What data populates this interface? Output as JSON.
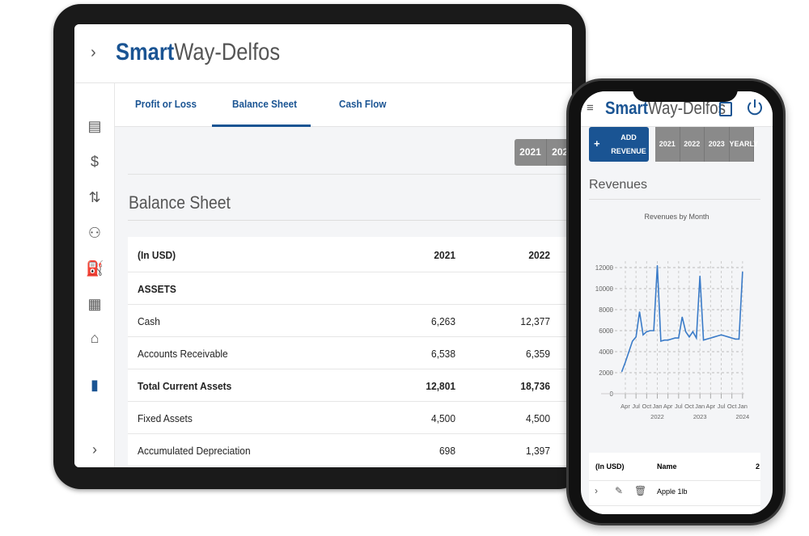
{
  "tablet": {
    "logo": {
      "bold": "Smart",
      "rest": "Way-Delfos"
    },
    "expand_icon": "chevron-right-icon",
    "header_icons": [
      "clipboard-icon",
      "power-icon"
    ],
    "sidebar_icons": [
      "dashboard-icon",
      "dollar-icon",
      "transfer-icon",
      "people-icon",
      "fuel-icon",
      "building-icon",
      "bank-icon",
      "document-icon"
    ],
    "tabs": [
      {
        "label": "Profit or Loss"
      },
      {
        "label": "Balance Sheet",
        "active": true
      },
      {
        "label": "Cash Flow"
      }
    ],
    "year_buttons": [
      "2021",
      "2022"
    ],
    "title": "Balance Sheet",
    "table": {
      "header": [
        "(In USD)",
        "2021",
        "2022"
      ],
      "rows": [
        {
          "label": "ASSETS",
          "v2021": "",
          "v2022": "",
          "bold": true
        },
        {
          "label": "Cash",
          "v2021": "6,263",
          "v2022": "12,377"
        },
        {
          "label": "Accounts Receivable",
          "v2021": "6,538",
          "v2022": "6,359"
        },
        {
          "label": "Total Current Assets",
          "v2021": "12,801",
          "v2022": "18,736",
          "bold": true
        },
        {
          "label": "Fixed Assets",
          "v2021": "4,500",
          "v2022": "4,500"
        },
        {
          "label": "Accumulated Depreciation",
          "v2021": "698",
          "v2022": "1,397"
        }
      ]
    }
  },
  "phone": {
    "logo": {
      "bold": "Smart",
      "rest": "Way-Delfos"
    },
    "add_button": {
      "icon": "+",
      "line1": "ADD",
      "line2": "REVENUE"
    },
    "period_buttons": [
      "2021",
      "2022",
      "2023",
      "YEARLY"
    ],
    "section_title": "Revenues",
    "table": {
      "header": [
        "(In USD)",
        "Name",
        "2"
      ],
      "rows": [
        {
          "name": "Apple 1lb"
        }
      ]
    }
  },
  "colors": {
    "brand": "#1a5493",
    "line": "#3a7bc8",
    "button_gray": "#8a8a8a"
  },
  "chart_data": {
    "type": "line",
    "title": "Revenues by Month",
    "x": [
      "2021-03",
      "2021-04",
      "2021-05",
      "2021-06",
      "2021-07",
      "2021-08",
      "2021-09",
      "2021-10",
      "2021-11",
      "2021-12",
      "2022-01",
      "2022-02",
      "2022-03",
      "2022-04",
      "2022-05",
      "2022-06",
      "2022-07",
      "2022-08",
      "2022-09",
      "2022-10",
      "2022-11",
      "2022-12",
      "2023-01",
      "2023-02",
      "2023-03",
      "2023-04",
      "2023-05",
      "2023-06",
      "2023-07",
      "2023-08",
      "2023-09",
      "2023-10",
      "2023-11",
      "2023-12",
      "2024-01"
    ],
    "values": [
      2100,
      3000,
      4000,
      5000,
      5400,
      7800,
      5600,
      5900,
      6000,
      6000,
      12200,
      5000,
      5100,
      5100,
      5200,
      5300,
      5300,
      7300,
      5900,
      5400,
      5900,
      5300,
      11200,
      5100,
      5200,
      5300,
      5400,
      5500,
      5600,
      5500,
      5400,
      5300,
      5200,
      5200,
      11600
    ],
    "yticks": [
      "0",
      "2000",
      "4000",
      "6000",
      "8000",
      "10000",
      "12000"
    ],
    "xticks": [
      {
        "m": "Apr",
        "y": ""
      },
      {
        "m": "Jul",
        "y": ""
      },
      {
        "m": "Oct",
        "y": ""
      },
      {
        "m": "Jan",
        "y": "2022"
      },
      {
        "m": "Apr",
        "y": ""
      },
      {
        "m": "Jul",
        "y": ""
      },
      {
        "m": "Oct",
        "y": ""
      },
      {
        "m": "Jan",
        "y": "2023"
      },
      {
        "m": "Apr",
        "y": ""
      },
      {
        "m": "Jul",
        "y": ""
      },
      {
        "m": "Oct",
        "y": ""
      },
      {
        "m": "Jan",
        "y": "2024"
      }
    ],
    "ylim": [
      0,
      12000
    ],
    "grid": true
  }
}
